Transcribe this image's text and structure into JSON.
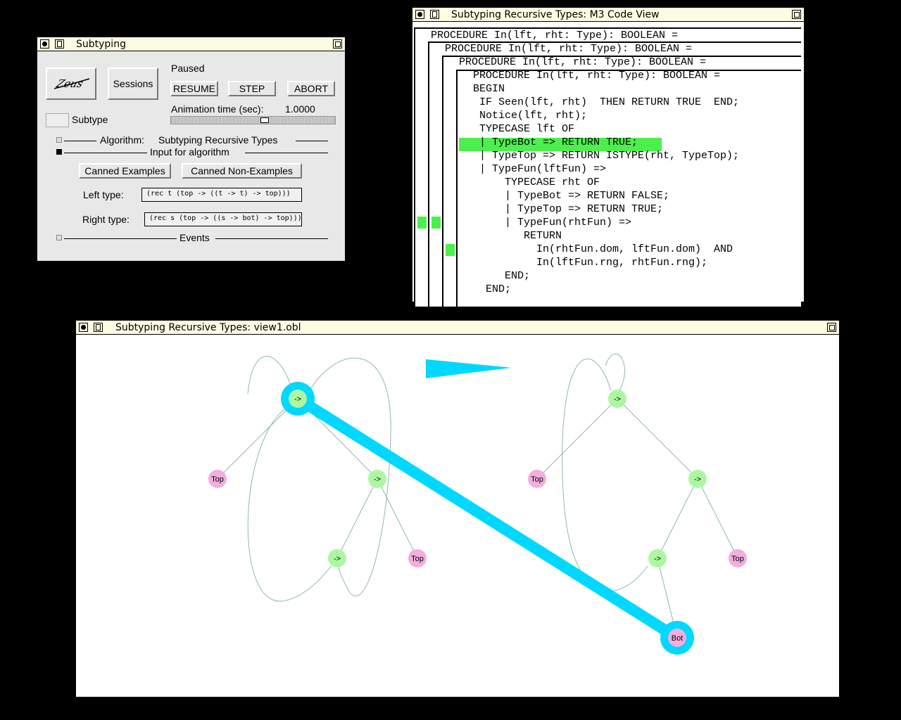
{
  "control_panel": {
    "title": "Subtyping",
    "zeus_label": "Zeus",
    "sessions_label": "Sessions",
    "status": "Paused",
    "resume_label": "RESUME",
    "step_label": "STEP",
    "abort_label": "ABORT",
    "animation_label": "Animation time (sec):",
    "animation_value": "1.0000",
    "view_label": "Subtype",
    "algorithm_label": "Algorithm:",
    "algorithm_value": "Subtyping Recursive Types",
    "input_label": "Input for algorithm",
    "canned_examples_label": "Canned Examples",
    "canned_nonexamples_label": "Canned Non-Examples",
    "left_type_label": "Left type:",
    "left_type_value": "(rec t (top -> ((t -> t) -> top)))",
    "right_type_label": "Right type:",
    "right_type_value": "(rec s (top -> ((s -> bot) -> top)))",
    "events_label": "Events"
  },
  "code_view": {
    "title": "Subtyping Recursive Types: M3 Code View",
    "lines": [
      "PROCEDURE In(lft, rht: Type): BOOLEAN =",
      "PROCEDURE In(lft, rht: Type): BOOLEAN =",
      "PROCEDURE In(lft, rht: Type): BOOLEAN =",
      "PROCEDURE In(lft, rht: Type): BOOLEAN =",
      "BEGIN",
      " IF Seen(lft, rht)  THEN RETURN TRUE  END;",
      " Notice(lft, rht);",
      " TYPECASE lft OF",
      " | TypeBot => RETURN TRUE;",
      " | TypeTop => RETURN ISTYPE(rht, TypeTop);",
      " | TypeFun(lftFun) =>",
      "     TYPECASE rht OF",
      "     | TypeBot => RETURN FALSE;",
      "     | TypeTop => RETURN TRUE;",
      "     | TypeFun(rhtFun) =>",
      "        RETURN",
      "          In(rhtFun.dom, lftFun.dom)  AND",
      "          In(lftFun.rng, rhtFun.rng);",
      "     END;",
      "  END;"
    ],
    "highlighted_line": 8
  },
  "graph_view": {
    "title": "Subtyping Recursive Types: view1.obl",
    "nodes": [
      "->",
      "Top",
      "->",
      "->",
      "Top",
      "->",
      "Top",
      "->",
      "->",
      "Top",
      "Bot"
    ],
    "colors": {
      "fun_node": "#adf7a0",
      "leaf_node": "#f3aedd",
      "highlight": "#00d8ff"
    }
  }
}
